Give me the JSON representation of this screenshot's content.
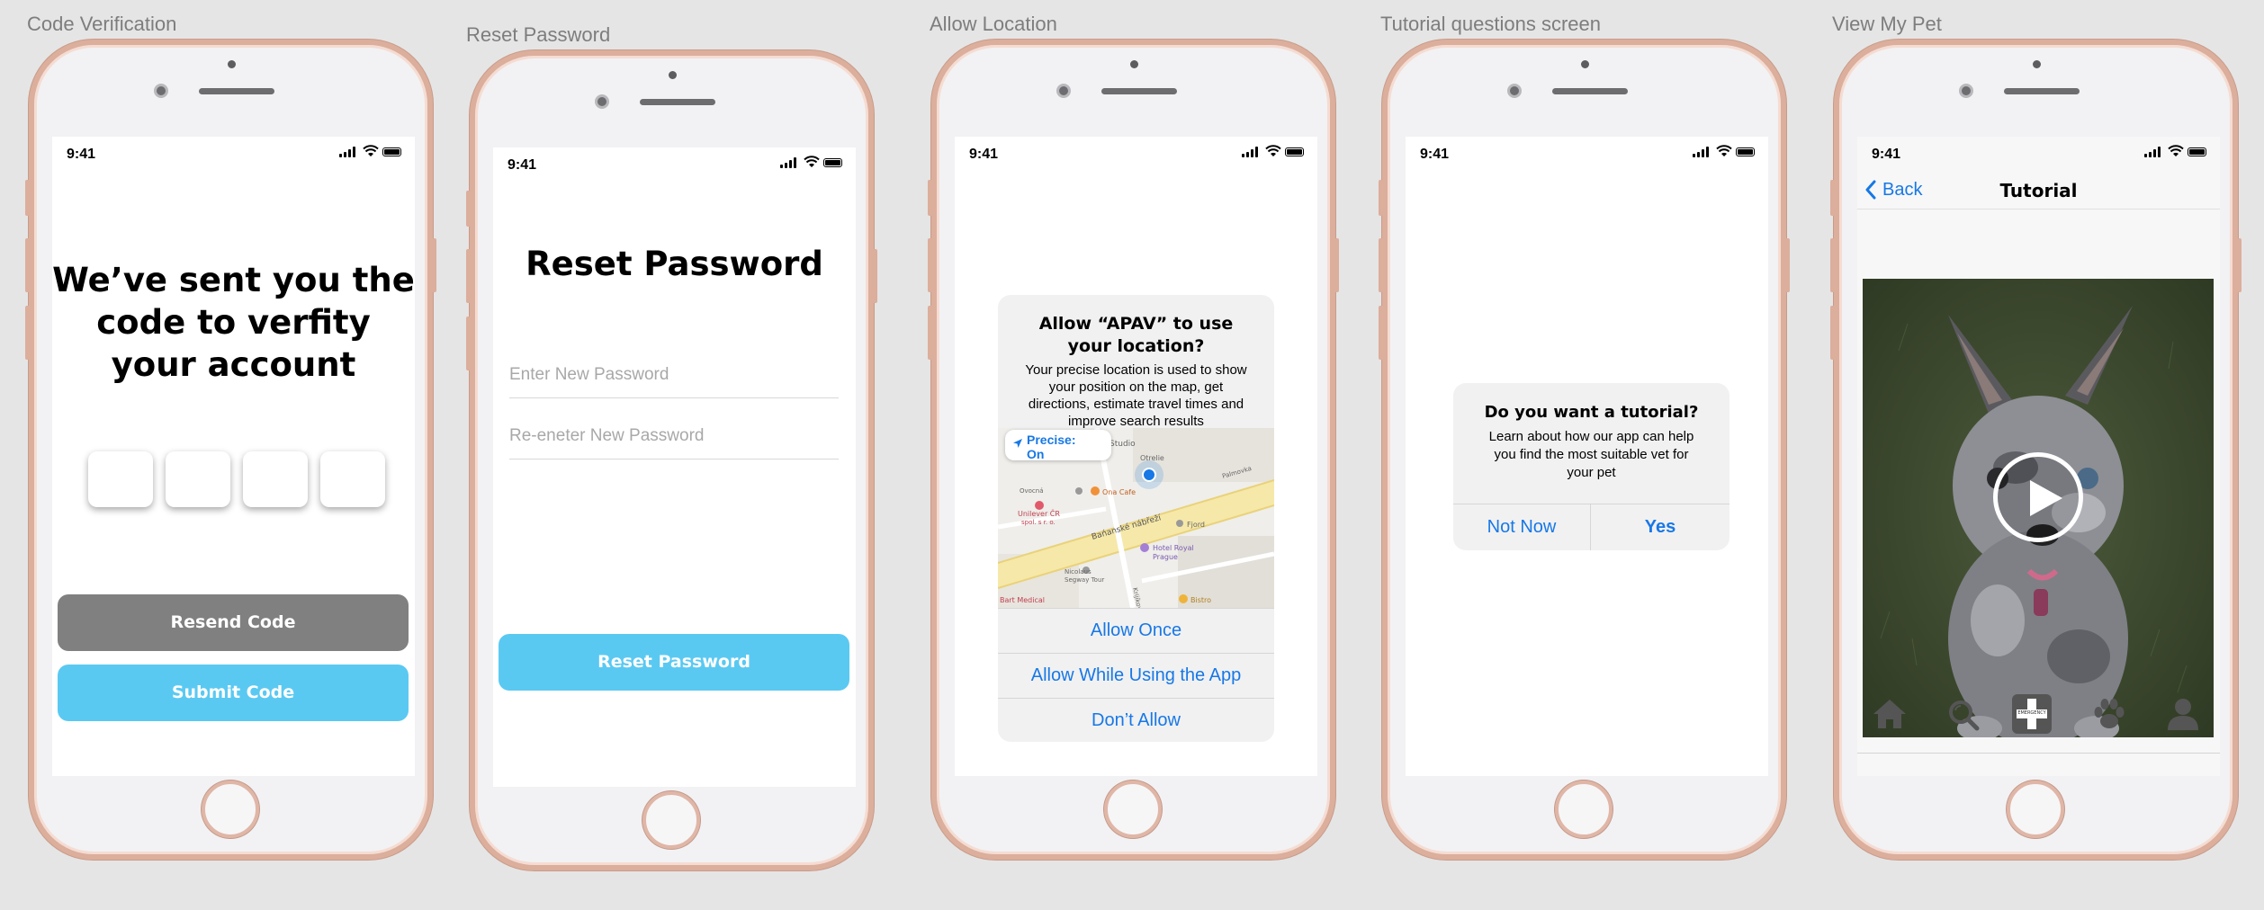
{
  "frames": [
    {
      "label": "Code Verification",
      "time": "9:41",
      "heading_lines": [
        "We’ve sent you the",
        "code to verfity",
        "your account"
      ],
      "resend_label": "Resend Code",
      "submit_label": "Submit Code"
    },
    {
      "label": "Reset Password",
      "time": "9:41",
      "heading": "Reset Password",
      "new_password_placeholder": "Enter New Password",
      "reenter_password_placeholder": "Re-eneter New Password",
      "reset_label": "Reset Password"
    },
    {
      "label": "Allow Location",
      "time": "9:41",
      "alert_title_lines": [
        "Allow “APAV” to use",
        "your location?"
      ],
      "alert_body_lines": [
        "Your precise location is used to show",
        "your position on the map, get",
        "directions, estimate travel times and",
        "improve search results"
      ],
      "precise_label": "Precise:",
      "precise_value": "On",
      "map_labels": [
        "Studio",
        "Otrelie",
        "Ona Cafe",
        "Unilever ČR",
        "spol. s r. o.",
        "Bańanské nábřeží",
        "Fjord",
        "Hotel Royal",
        "Prague",
        "Nicolaus",
        "Segway Tour",
        "Bart Medical",
        "Ovocná",
        "Krijíkova",
        "Bistro",
        "Palmovka"
      ],
      "actions": [
        "Allow Once",
        "Allow While Using the App",
        "Don’t Allow"
      ]
    },
    {
      "label": "Tutorial questions screen",
      "time": "9:41",
      "alert_title": "Do you want a tutorial?",
      "alert_body_lines": [
        "Learn about how our app can help",
        "you find the most suitable vet for",
        "your pet"
      ],
      "not_now_label": "Not Now",
      "yes_label": "Yes"
    },
    {
      "label": "View My Pet",
      "time": "9:41",
      "back_label": "Back",
      "nav_title": "Tutorial",
      "emergency_label": "EMERGENCY",
      "tab_icons": [
        "home-icon",
        "search-icon",
        "emergency-icon",
        "paw-icon",
        "profile-icon"
      ]
    }
  ],
  "colors": {
    "background": "#e5e5e5",
    "phone_frame": "#dcae9c",
    "gray_button": "#808080",
    "blue_button": "#5ac9f2",
    "ios_blue": "#1778e6",
    "label": "#7d7d7d"
  }
}
